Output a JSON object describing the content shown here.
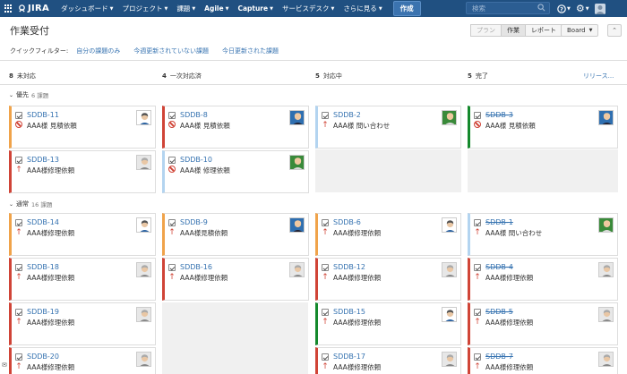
{
  "nav": {
    "brand": "JIRA",
    "menu": [
      "ダッシュボード",
      "プロジェクト",
      "課題",
      "Agile",
      "Capture",
      "サービスデスク",
      "さらに見る"
    ],
    "create": "作成",
    "search_placeholder": "検索",
    "help_icon": "help-icon",
    "settings_icon": "gear-icon",
    "colors": {
      "nav_bg": "#205081",
      "create_bg": "#3b73af"
    }
  },
  "header": {
    "title": "作業受付",
    "views": [
      "プラン",
      "作業",
      "レポート"
    ],
    "active_view": "作業",
    "board": "Board",
    "collapse_icon": "collapse-icon"
  },
  "quickfilters": {
    "label": "クイックフィルター:",
    "items": [
      "自分の課題のみ",
      "今週更新されていない課題",
      "今日更新された課題"
    ]
  },
  "columns": [
    {
      "count": "8",
      "name": "未対応"
    },
    {
      "count": "4",
      "name": "一次対応済"
    },
    {
      "count": "5",
      "name": "対応中"
    },
    {
      "count": "5",
      "name": "完了"
    }
  ],
  "release_link": "リリース...",
  "swimlanes": [
    {
      "name": "優先",
      "count": "6 課題",
      "cards": [
        {
          "col": 0,
          "row": 0,
          "key": "SDDB-11",
          "summary": "AAA様 見積依頼",
          "priority": "blocker",
          "border": "orange",
          "avatar": "white",
          "done": false
        },
        {
          "col": 0,
          "row": 1,
          "key": "SDDB-13",
          "summary": "AAA様修理依頼",
          "priority": "high",
          "border": "red",
          "avatar": "gray",
          "done": false
        },
        {
          "col": 1,
          "row": 0,
          "key": "SDDB-8",
          "summary": "AAA様 見積依頼",
          "priority": "blocker",
          "border": "red",
          "avatar": "blue",
          "done": false
        },
        {
          "col": 1,
          "row": 1,
          "key": "SDDB-10",
          "summary": "AAA様 修理依頼",
          "priority": "blocker",
          "border": "blue",
          "avatar": "green",
          "done": false
        },
        {
          "col": 2,
          "row": 0,
          "key": "SDDB-2",
          "summary": "AAA様 問い合わせ",
          "priority": "high",
          "border": "blue",
          "avatar": "green",
          "done": false
        },
        {
          "col": 3,
          "row": 0,
          "key": "SDDB-3",
          "summary": "AAA様 見積依頼",
          "priority": "blocker",
          "border": "green",
          "avatar": "blue",
          "done": true
        }
      ]
    },
    {
      "name": "通常",
      "count": "16 課題",
      "cards": [
        {
          "col": 0,
          "row": 0,
          "key": "SDDB-14",
          "summary": "AAA様修理依頼",
          "priority": "high",
          "border": "orange",
          "avatar": "white",
          "done": false
        },
        {
          "col": 0,
          "row": 1,
          "key": "SDDB-18",
          "summary": "AAA様修理依頼",
          "priority": "high",
          "border": "red",
          "avatar": "gray",
          "done": false
        },
        {
          "col": 0,
          "row": 2,
          "key": "SDDB-19",
          "summary": "AAA様修理依頼",
          "priority": "high",
          "border": "red",
          "avatar": "gray",
          "done": false
        },
        {
          "col": 0,
          "row": 3,
          "key": "SDDB-20",
          "summary": "AAA様修理依頼",
          "priority": "high",
          "border": "red",
          "avatar": "gray",
          "done": false
        },
        {
          "col": 1,
          "row": 0,
          "key": "SDDB-9",
          "summary": "AAA様見積依頼",
          "priority": "high",
          "border": "orange",
          "avatar": "blue",
          "done": false
        },
        {
          "col": 1,
          "row": 1,
          "key": "SDDB-16",
          "summary": "AAA様修理依頼",
          "priority": "high",
          "border": "red",
          "avatar": "gray",
          "done": false
        },
        {
          "col": 2,
          "row": 0,
          "key": "SDDB-6",
          "summary": "AAA様修理依頼",
          "priority": "high",
          "border": "orange",
          "avatar": "white",
          "done": false
        },
        {
          "col": 2,
          "row": 1,
          "key": "SDDB-12",
          "summary": "AAA様修理依頼",
          "priority": "high",
          "border": "red",
          "avatar": "gray",
          "done": false
        },
        {
          "col": 2,
          "row": 2,
          "key": "SDDB-15",
          "summary": "AAA様修理依頼",
          "priority": "high",
          "border": "green",
          "avatar": "white",
          "done": false
        },
        {
          "col": 2,
          "row": 3,
          "key": "SDDB-17",
          "summary": "AAA様修理依頼",
          "priority": "high",
          "border": "red",
          "avatar": "gray",
          "done": false
        },
        {
          "col": 3,
          "row": 0,
          "key": "SDDB-1",
          "summary": "AAA様 問い合わせ",
          "priority": "high",
          "border": "blue",
          "avatar": "green",
          "done": true
        },
        {
          "col": 3,
          "row": 1,
          "key": "SDDB-4",
          "summary": "AAA様修理依頼",
          "priority": "high",
          "border": "red",
          "avatar": "gray",
          "done": true
        },
        {
          "col": 3,
          "row": 2,
          "key": "SDDB-5",
          "summary": "AAA様修理依頼",
          "priority": "high",
          "border": "red",
          "avatar": "gray",
          "done": true
        },
        {
          "col": 3,
          "row": 3,
          "key": "SDDB-7",
          "summary": "AAA様修理依頼",
          "priority": "high",
          "border": "red",
          "avatar": "gray",
          "done": true
        }
      ]
    }
  ]
}
